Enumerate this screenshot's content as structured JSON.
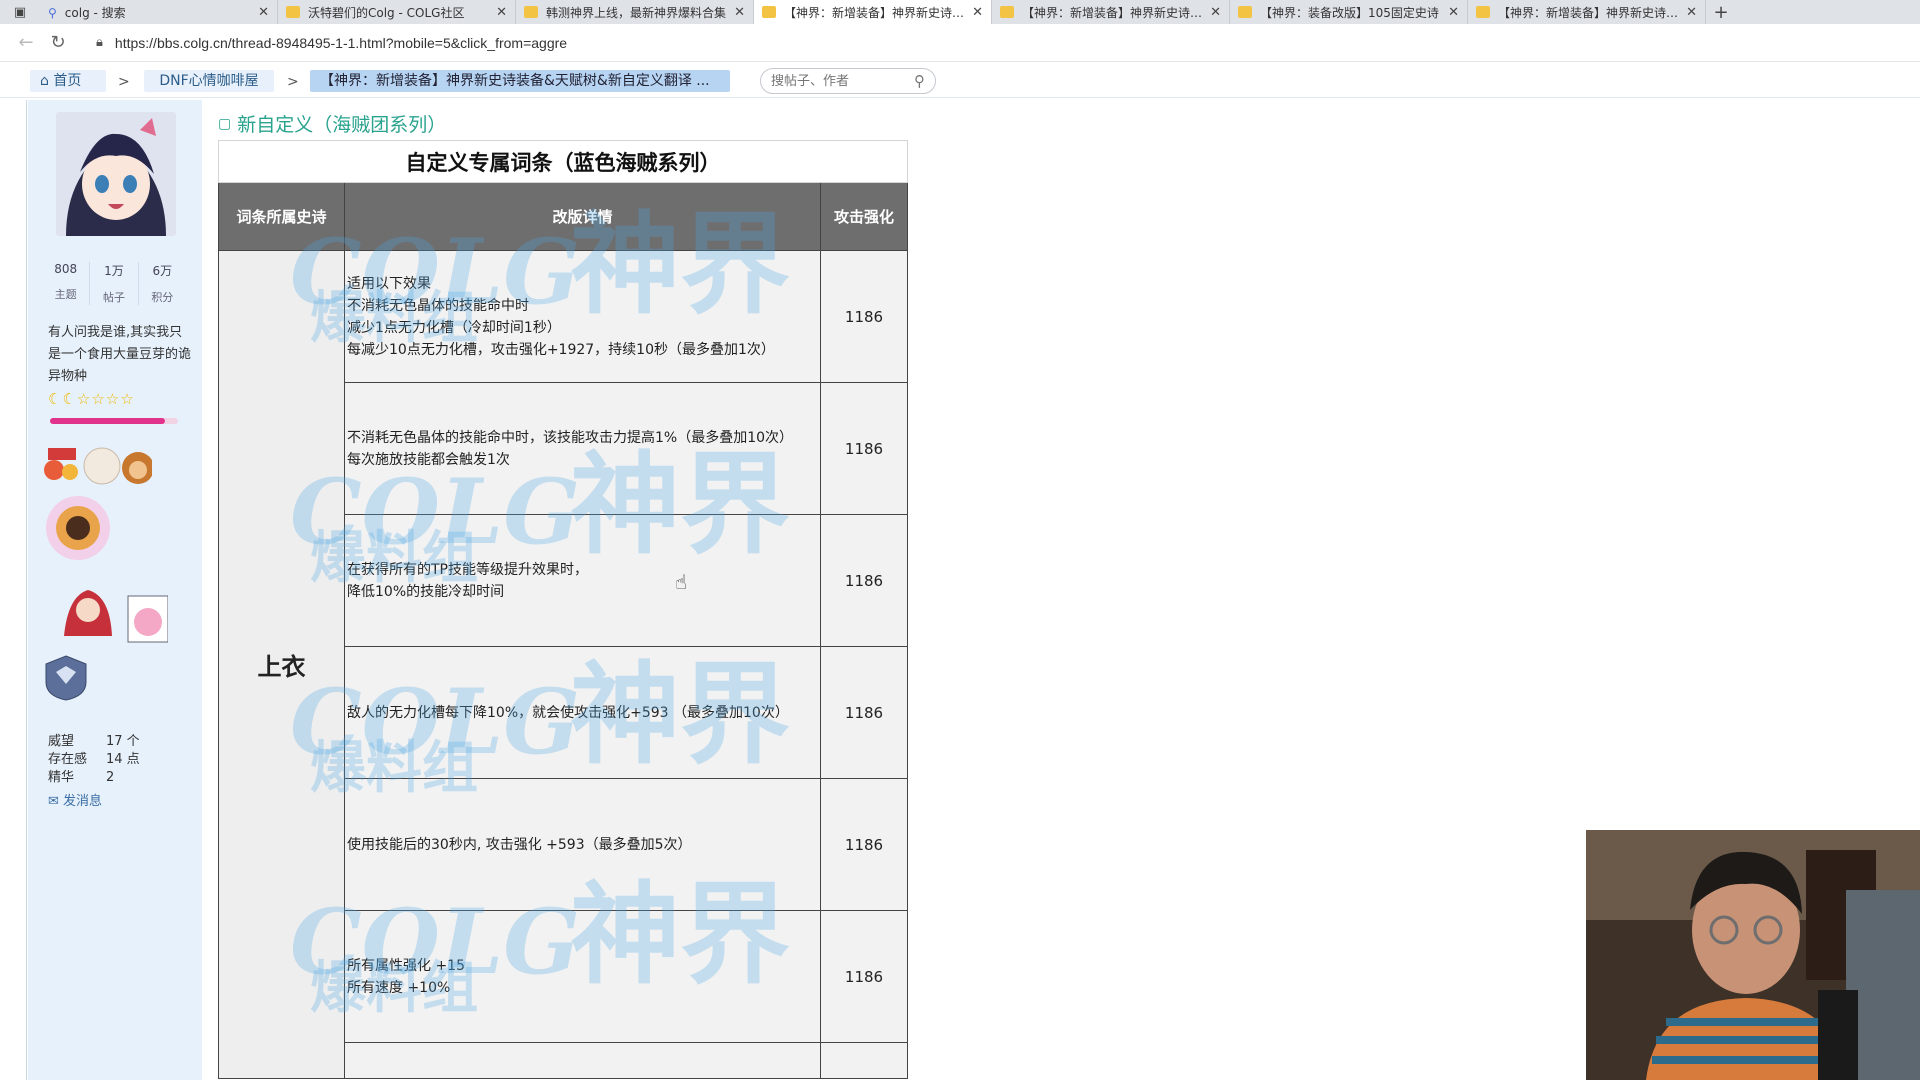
{
  "browser": {
    "tabs": [
      {
        "title": "colg - 搜索",
        "icon": "search-icon",
        "active": false
      },
      {
        "title": "沃特碧们的Colg - COLG社区",
        "icon": "folder-icon",
        "active": false
      },
      {
        "title": "韩测神界上线，最新神界爆料合集",
        "icon": "folder-icon",
        "active": false
      },
      {
        "title": "【神界：新增装备】神界新史诗装备",
        "icon": "folder-icon",
        "active": true
      },
      {
        "title": "【神界：新增装备】神界新史诗装备",
        "icon": "folder-icon",
        "active": false
      },
      {
        "title": "【神界：装备改版】105固定史诗",
        "icon": "folder-icon",
        "active": false
      },
      {
        "title": "【神界：新增装备】神界新史诗装备",
        "icon": "folder-icon",
        "active": false
      }
    ],
    "url": "https://bbs.colg.cn/thread-8948495-1-1.html?mobile=5&click_from=aggre"
  },
  "breadcrumb": {
    "home": "首页",
    "forum": "DNF心情咖啡屋",
    "thread": "【神界：新增装备】神界新史诗装备&天赋树&新自定义翻译 ..."
  },
  "search": {
    "placeholder": "搜帖子、作者"
  },
  "profile": {
    "stats": [
      {
        "num": "808",
        "label": "主题"
      },
      {
        "num": "1万",
        "label": "帖子"
      },
      {
        "num": "6万",
        "label": "积分"
      }
    ],
    "signature": "有人问我是谁,其实我只是一个食用大量豆芽的诡异物种",
    "stars": "☾☾☆☆☆☆",
    "rank_progress": 0.9,
    "info": [
      {
        "key": "威望",
        "value": "17 个"
      },
      {
        "key": "存在感",
        "value": "14 点"
      },
      {
        "key": "精华",
        "value": "2"
      }
    ],
    "message_link": "发消息"
  },
  "post": {
    "heading": "新自定义（海贼团系列）",
    "table": {
      "title": "自定义专属词条（蓝色海贼系列）",
      "headers": [
        "词条所属史诗",
        "改版详情",
        "攻击强化"
      ],
      "category": "上衣",
      "rows": [
        {
          "lines": [
            "适用以下效果",
            "不消耗无色晶体的技能命中时",
            "减少1点无力化槽（冷却时间1秒）",
            "每减少10点无力化槽，攻击强化+1927，持续10秒（最多叠加1次）"
          ],
          "value": "1186"
        },
        {
          "lines": [
            "不消耗无色晶体的技能命中时，该技能攻击力提高1%（最多叠加10次）",
            "每次施放技能都会触发1次"
          ],
          "value": "1186"
        },
        {
          "lines": [
            "在获得所有的TP技能等级提升效果时，",
            "降低10%的技能冷却时间"
          ],
          "value": "1186"
        },
        {
          "lines": [
            "敌人的无力化槽每下降10%，就会使攻击强化+593 （最多叠加10次）"
          ],
          "value": "1186"
        },
        {
          "lines": [
            "使用技能后的30秒内, 攻击强化 +593（最多叠加5次）"
          ],
          "value": "1186"
        },
        {
          "lines": [
            "所有属性强化 +15",
            "所有速度 +10%"
          ],
          "value": "1186"
        }
      ]
    },
    "watermark": {
      "latin": "COLG",
      "cn": "神界",
      "sub": "爆料组"
    }
  }
}
